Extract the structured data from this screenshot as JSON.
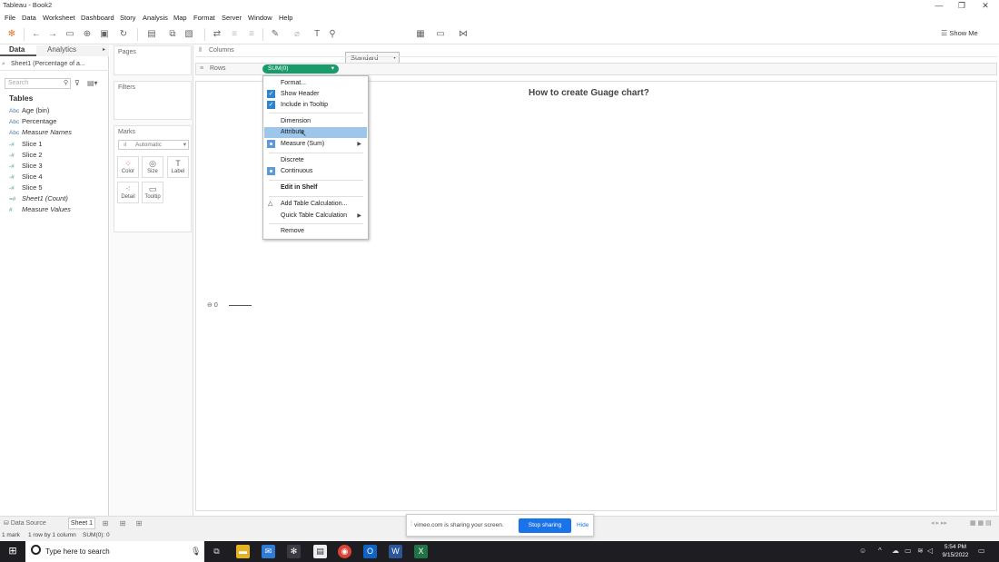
{
  "window": {
    "title": "Tableau - Book2",
    "controls": [
      "—",
      "❐",
      "✕"
    ]
  },
  "menu_bar": [
    "File",
    "Data",
    "Worksheet",
    "Dashboard",
    "Story",
    "Analysis",
    "Map",
    "Format",
    "Server",
    "Window",
    "Help"
  ],
  "toolbar": {
    "fit_select": "Standard",
    "show_me": "Show Me"
  },
  "data_pane": {
    "tabs": [
      "Data",
      "Analytics"
    ],
    "datasource": "Sheet1 (Percentage of a...",
    "search_placeholder": "Search",
    "tables_label": "Tables",
    "fields": [
      {
        "type": "Abc",
        "label": "Age (bin)"
      },
      {
        "type": "Abc",
        "label": "Percentage"
      },
      {
        "type": "Abc",
        "label": "Measure Names"
      },
      {
        "type": "#",
        "label": "Slice 1"
      },
      {
        "type": "#",
        "label": "Slice 2"
      },
      {
        "type": "#",
        "label": "Slice 3"
      },
      {
        "type": "#",
        "label": "Slice 4"
      },
      {
        "type": "#",
        "label": "Slice 5"
      },
      {
        "type": "#",
        "label": "Sheet1 (Count)"
      },
      {
        "type": "#",
        "label": "Measure Values"
      }
    ]
  },
  "cards": {
    "pages": "Pages",
    "filters": "Filters",
    "marks": "Marks",
    "mark_type": "Automatic",
    "mark_buttons": [
      "Color",
      "Size",
      "Label",
      "Detail",
      "Tooltip"
    ]
  },
  "shelves": {
    "columns": "Columns",
    "rows": "Rows",
    "pill": "SUM(0)"
  },
  "context_menu": [
    {
      "label": "Format...",
      "marker": ""
    },
    {
      "label": "Show Header",
      "marker": "check"
    },
    {
      "label": "Include in Tooltip",
      "marker": "check"
    },
    {
      "label": "Dimension",
      "marker": ""
    },
    {
      "label": "Attribute",
      "marker": "",
      "highlighted": true
    },
    {
      "label": "Measure (Sum)",
      "marker": "dot",
      "submenu": true
    },
    {
      "label": "Discrete",
      "marker": ""
    },
    {
      "label": "Continuous",
      "marker": "dot"
    },
    {
      "label": "Edit in Shelf",
      "marker": "",
      "bold": true
    },
    {
      "label": "Add Table Calculation...",
      "marker": "triangle"
    },
    {
      "label": "Quick Table Calculation",
      "marker": "",
      "submenu": true
    },
    {
      "label": "Remove",
      "marker": ""
    }
  ],
  "view": {
    "title": "How to create Guage chart?",
    "axis_tick": "0"
  },
  "sheets": {
    "datasource_tab": "Data Source",
    "sheet_tab": "Sheet 1"
  },
  "status": {
    "marks": "1 mark",
    "dims": "1 row by 1 column",
    "sum": "SUM(0): 0"
  },
  "sharing": {
    "text": "vimeo.com is sharing your screen.",
    "stop": "Stop sharing",
    "hide": "Hide"
  },
  "taskbar": {
    "search_placeholder": "Type here to search",
    "time": "5:54 PM",
    "date": "9/15/2022"
  }
}
